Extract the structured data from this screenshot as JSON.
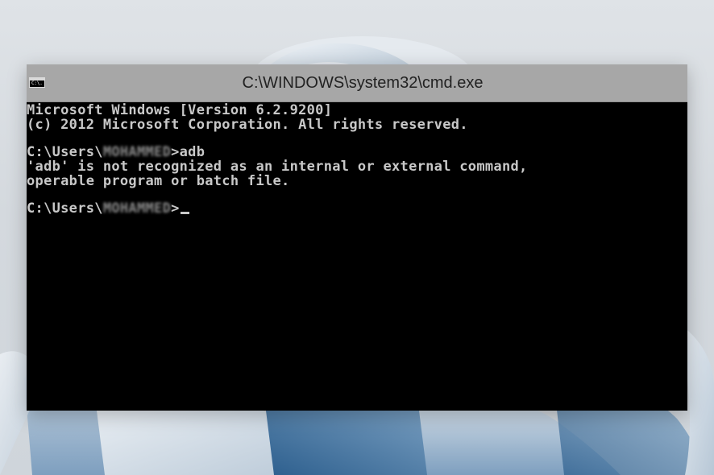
{
  "window": {
    "title": "C:\\WINDOWS\\system32\\cmd.exe",
    "icon_name": "cmd-app-icon",
    "icon_glyph": "C:\\."
  },
  "console": {
    "lines": [
      {
        "text": "Microsoft Windows [Version 6.2.9200]"
      },
      {
        "text": "(c) 2012 Microsoft Corporation. All rights reserved."
      },
      {
        "text": ""
      },
      {
        "prefix": "C:\\Users\\",
        "redacted": "MOHAMMED",
        "suffix": ">adb"
      },
      {
        "text": "'adb' is not recognized as an internal or external command,"
      },
      {
        "text": "operable program or batch file."
      },
      {
        "text": ""
      },
      {
        "prefix": "C:\\Users\\",
        "redacted": "MOHAMMED",
        "suffix": ">"
      }
    ]
  },
  "colors": {
    "console_background": "#000000",
    "console_text": "#c8c8c8",
    "titlebar": "#a7a7a7"
  }
}
